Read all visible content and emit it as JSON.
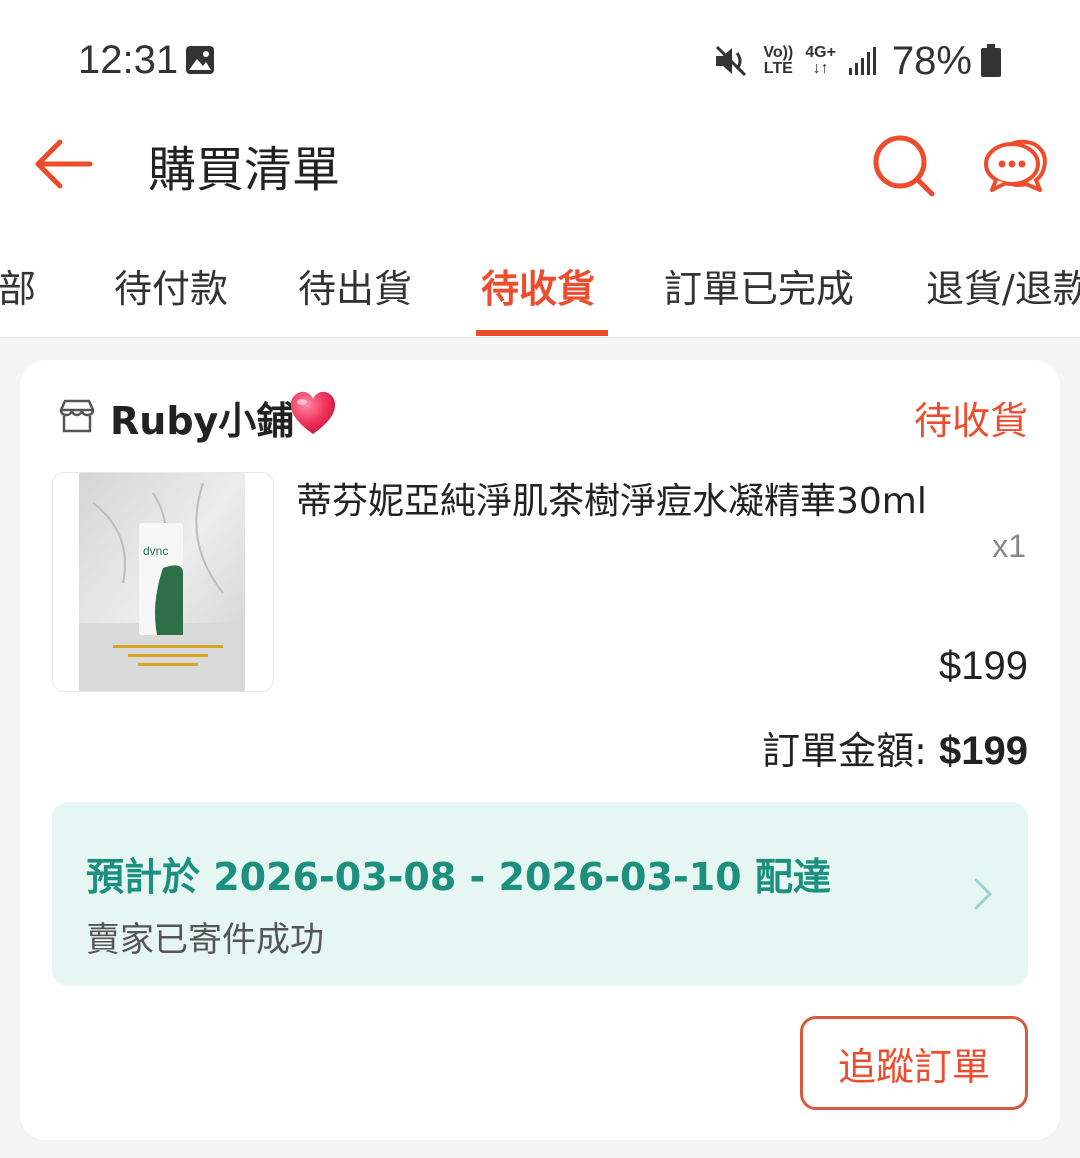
{
  "status_bar": {
    "time": "12:31",
    "volte_top": "Vo))",
    "volte_bottom": "LTE",
    "network_top": "4G+",
    "network_bottom": "↓↑",
    "battery": "78%"
  },
  "header": {
    "title": "購買清單"
  },
  "tabs": [
    {
      "label": "全部"
    },
    {
      "label": "待付款"
    },
    {
      "label": "待出貨"
    },
    {
      "label": "待收貨"
    },
    {
      "label": "訂單已完成"
    },
    {
      "label": "退貨/退款"
    }
  ],
  "active_tab_index": 3,
  "order": {
    "shop_name": "Ruby小鋪",
    "status": "待收貨",
    "product_name": "蒂芬妮亞純淨肌茶樹淨痘水凝精華30ml",
    "quantity": "x1",
    "price": "$199",
    "total_label": "訂單金額: ",
    "total_value": "$199",
    "delivery_estimate": "預計於 2026-03-08 - 2026-03-10 配達",
    "delivery_status": "賣家已寄件成功",
    "track_button": "追蹤訂單"
  },
  "colors": {
    "accent": "#ee4d2d",
    "delivery_bg": "#e6f6f3",
    "delivery_text": "#1d8f7f"
  }
}
